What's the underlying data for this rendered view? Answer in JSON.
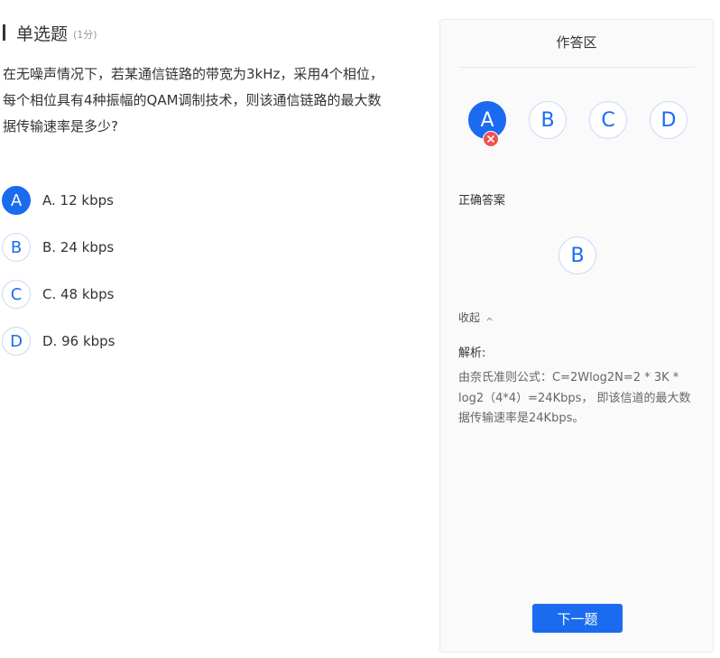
{
  "question": {
    "type_label": "单选题",
    "score_label": "(1分)",
    "stem_lines": [
      "在无噪声情况下，若某通信链路的带宽为3kHz，采用4个相位，",
      "每个相位具有4种振幅的QAM调制技术，则该通信链路的最大数",
      "据传输速率是多少?"
    ],
    "options": [
      {
        "letter": "A",
        "text": "A. 12 kbps",
        "selected": true
      },
      {
        "letter": "B",
        "text": "B. 24 kbps",
        "selected": false
      },
      {
        "letter": "C",
        "text": "C. 48 kbps",
        "selected": false
      },
      {
        "letter": "D",
        "text": "D. 96 kbps",
        "selected": false
      }
    ]
  },
  "panel": {
    "title": "作答区",
    "answer_choices": [
      "A",
      "B",
      "C",
      "D"
    ],
    "selected_answer": "A",
    "correct_label": "正确答案",
    "correct_answer": "B",
    "collapse_label": "收起",
    "collapse_icon": "chevron-up-icon",
    "analysis_label": "解析:",
    "analysis_lines": [
      "由奈氏准则公式：C=2Wlog2N=2 * 3K *",
      "log2（4*4）=24Kbps， 即该信道的最大数",
      "据传输速率是24Kbps。"
    ],
    "next_button_label": "下一题"
  },
  "colors": {
    "accent": "#1a6bf0",
    "wrong": "#f0514f",
    "panel_bg": "#fafafa"
  }
}
